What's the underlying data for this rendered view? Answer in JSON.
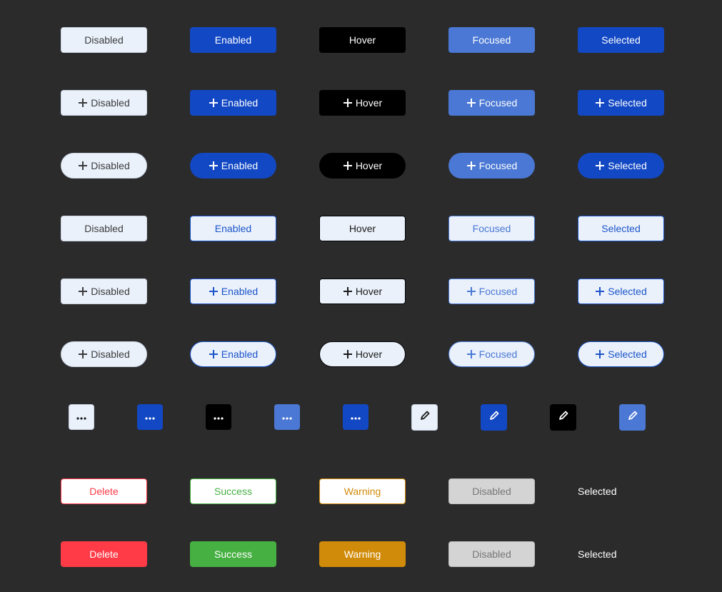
{
  "row1": {
    "disabled": "Disabled",
    "enabled": "Enabled",
    "hover": "Hover",
    "focused": "Focused",
    "selected": "Selected"
  },
  "row2": {
    "disabled": "Disabled",
    "enabled": "Enabled",
    "hover": "Hover",
    "focused": "Focused",
    "selected": "Selected"
  },
  "row3": {
    "disabled": "Disabled",
    "enabled": "Enabled",
    "hover": "Hover",
    "focused": "Focused",
    "selected": "Selected"
  },
  "row4": {
    "disabled": "Disabled",
    "enabled": "Enabled",
    "hover": "Hover",
    "focused": "Focused",
    "selected": "Selected"
  },
  "row5": {
    "disabled": "Disabled",
    "enabled": "Enabled",
    "hover": "Hover",
    "focused": "Focused",
    "selected": "Selected"
  },
  "row6": {
    "disabled": "Disabled",
    "enabled": "Enabled",
    "hover": "Hover",
    "focused": "Focused",
    "selected": "Selected"
  },
  "icons": {
    "more": "more-horizontal-icon",
    "edit": "pencil-icon",
    "add": "plus-icon"
  },
  "row8": {
    "delete": "Delete",
    "success": "Success",
    "warning": "Warning",
    "disabled": "Disabled",
    "selected": "Selected"
  },
  "row9": {
    "delete": "Delete",
    "success": "Success",
    "warning": "Warning",
    "disabled": "Disabled",
    "selected": "Selected"
  },
  "colors": {
    "background": "#2b2b2b",
    "primary": "#1248c4",
    "focused": "#4a78d4",
    "hover": "#000000",
    "light": "#eaf1fb",
    "danger": "#ff3b47",
    "success": "#47b043",
    "warning": "#d08b0a",
    "disabled": "#d4d4d4"
  }
}
